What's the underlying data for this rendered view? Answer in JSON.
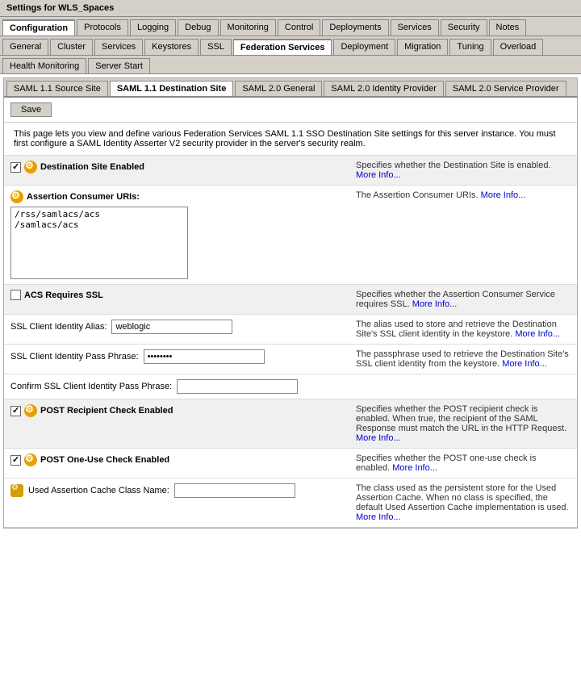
{
  "window": {
    "title": "Settings for WLS_Spaces"
  },
  "tabs_row1": [
    {
      "label": "Configuration",
      "active": true
    },
    {
      "label": "Protocols"
    },
    {
      "label": "Logging"
    },
    {
      "label": "Debug"
    },
    {
      "label": "Monitoring"
    },
    {
      "label": "Control"
    },
    {
      "label": "Deployments"
    },
    {
      "label": "Services"
    },
    {
      "label": "Security"
    },
    {
      "label": "Notes"
    }
  ],
  "tabs_row2": [
    {
      "label": "General"
    },
    {
      "label": "Cluster"
    },
    {
      "label": "Services"
    },
    {
      "label": "Keystores"
    },
    {
      "label": "SSL"
    },
    {
      "label": "Federation Services",
      "active": true
    },
    {
      "label": "Deployment"
    },
    {
      "label": "Migration"
    },
    {
      "label": "Tuning"
    },
    {
      "label": "Overload"
    }
  ],
  "tabs_row3": [
    {
      "label": "Health Monitoring"
    },
    {
      "label": "Server Start"
    }
  ],
  "subtabs": [
    {
      "label": "SAML 1.1 Source Site"
    },
    {
      "label": "SAML 1.1 Destination Site",
      "active": true
    },
    {
      "label": "SAML 2.0 General"
    },
    {
      "label": "SAML 2.0 Identity Provider"
    },
    {
      "label": "SAML 2.0 Service Provider"
    }
  ],
  "save_button": "Save",
  "description": "This page lets you view and define various Federation Services SAML 1.1 SSO Destination Site settings for this server instance. You must first configure a SAML Identity Asserter V2 security provider in the server's security realm.",
  "fields": [
    {
      "id": "destination-site-enabled",
      "label": "Destination Site Enabled",
      "type": "checkbox",
      "checked": true,
      "has_icon": true,
      "shaded": true,
      "help_text": "Specifies whether the Destination Site is enabled.",
      "more_info": "More Info..."
    },
    {
      "id": "assertion-consumer-uris",
      "label": "Assertion Consumer URIs:",
      "type": "textarea",
      "value": "/rss/samlacs/acs\n/samlacs/acs",
      "has_icon": true,
      "shaded": false,
      "help_text": "The Assertion Consumer URIs.",
      "more_info": "More Info..."
    },
    {
      "id": "acs-requires-ssl",
      "label": "ACS Requires SSL",
      "type": "checkbox",
      "checked": false,
      "has_icon": false,
      "shaded": true,
      "help_text": "Specifies whether the Assertion Consumer Service requires SSL.",
      "more_info": "More Info..."
    },
    {
      "id": "ssl-client-identity-alias",
      "label": "SSL Client Identity Alias:",
      "type": "text",
      "value": "weblogic",
      "has_icon": false,
      "shaded": false,
      "help_text": "The alias used to store and retrieve the Destination Site's SSL client identity in the keystore.",
      "more_info": "More Info..."
    },
    {
      "id": "ssl-client-identity-pass-phrase",
      "label": "SSL Client Identity Pass Phrase:",
      "type": "password",
      "value": "••••••••",
      "has_icon": false,
      "shaded": false,
      "help_text": "The passphrase used to retrieve the Destination Site's SSL client identity from the keystore.",
      "more_info": "More Info..."
    },
    {
      "id": "confirm-ssl-client-identity-pass-phrase",
      "label": "Confirm SSL Client Identity Pass Phrase:",
      "type": "text",
      "value": "",
      "has_icon": false,
      "shaded": false,
      "help_text": "",
      "more_info": ""
    },
    {
      "id": "post-recipient-check-enabled",
      "label": "POST Recipient Check Enabled",
      "type": "checkbox",
      "checked": true,
      "has_icon": true,
      "shaded": true,
      "help_text": "Specifies whether the POST recipient check is enabled. When true, the recipient of the SAML Response must match the URL in the HTTP Request.",
      "more_info": "More Info..."
    },
    {
      "id": "post-one-use-check-enabled",
      "label": "POST One-Use Check Enabled",
      "type": "checkbox",
      "checked": true,
      "has_icon": true,
      "shaded": false,
      "help_text": "Specifies whether the POST one-use check is enabled.",
      "more_info": "More Info..."
    },
    {
      "id": "used-assertion-cache-class-name",
      "label": "Used Assertion Cache Class Name:",
      "type": "text",
      "value": "",
      "has_icon": true,
      "shaded": false,
      "help_text": "The class used as the persistent store for the Used Assertion Cache. When no class is specified, the default Used Assertion Cache implementation is used.",
      "more_info": "More Info..."
    }
  ]
}
